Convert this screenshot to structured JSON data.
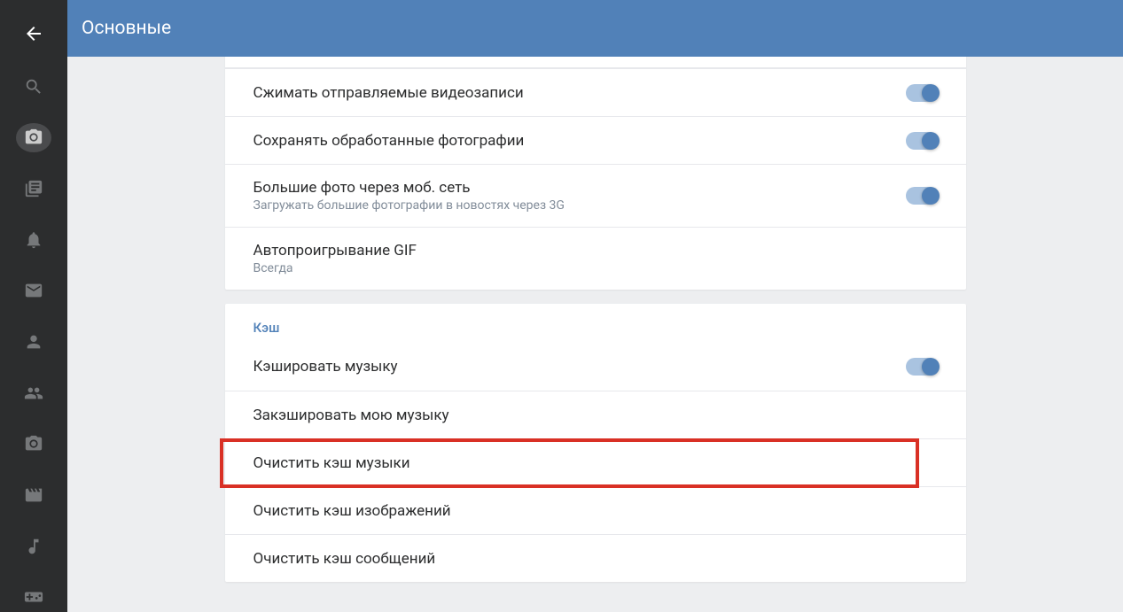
{
  "header": {
    "title": "Основные"
  },
  "sidebar": {
    "icons": [
      {
        "name": "back-arrow-icon"
      },
      {
        "name": "search-icon"
      },
      {
        "name": "camera-icon",
        "active": true
      },
      {
        "name": "news-icon"
      },
      {
        "name": "bell-icon"
      },
      {
        "name": "mail-icon"
      },
      {
        "name": "person-icon"
      },
      {
        "name": "people-icon"
      },
      {
        "name": "photo-icon"
      },
      {
        "name": "video-icon"
      },
      {
        "name": "music-icon"
      },
      {
        "name": "games-icon"
      }
    ]
  },
  "sections": {
    "media": {
      "rows": [
        {
          "title": "Сжимать отправляемые видеозаписи",
          "toggle": true
        },
        {
          "title": "Сохранять обработанные фотографии",
          "toggle": true
        },
        {
          "title": "Большие фото через моб. сеть",
          "subtitle": "Загружать большие фотографии в новостях через 3G",
          "toggle": true
        },
        {
          "title": "Автопроигрывание GIF",
          "subtitle": "Всегда"
        }
      ]
    },
    "cache": {
      "header": "Кэш",
      "rows": [
        {
          "title": "Кэшировать музыку",
          "toggle": true
        },
        {
          "title": "Закэшировать мою музыку"
        },
        {
          "title": "Очистить кэш музыки",
          "highlighted": true
        },
        {
          "title": "Очистить кэш изображений"
        },
        {
          "title": "Очистить кэш сообщений"
        }
      ]
    }
  }
}
